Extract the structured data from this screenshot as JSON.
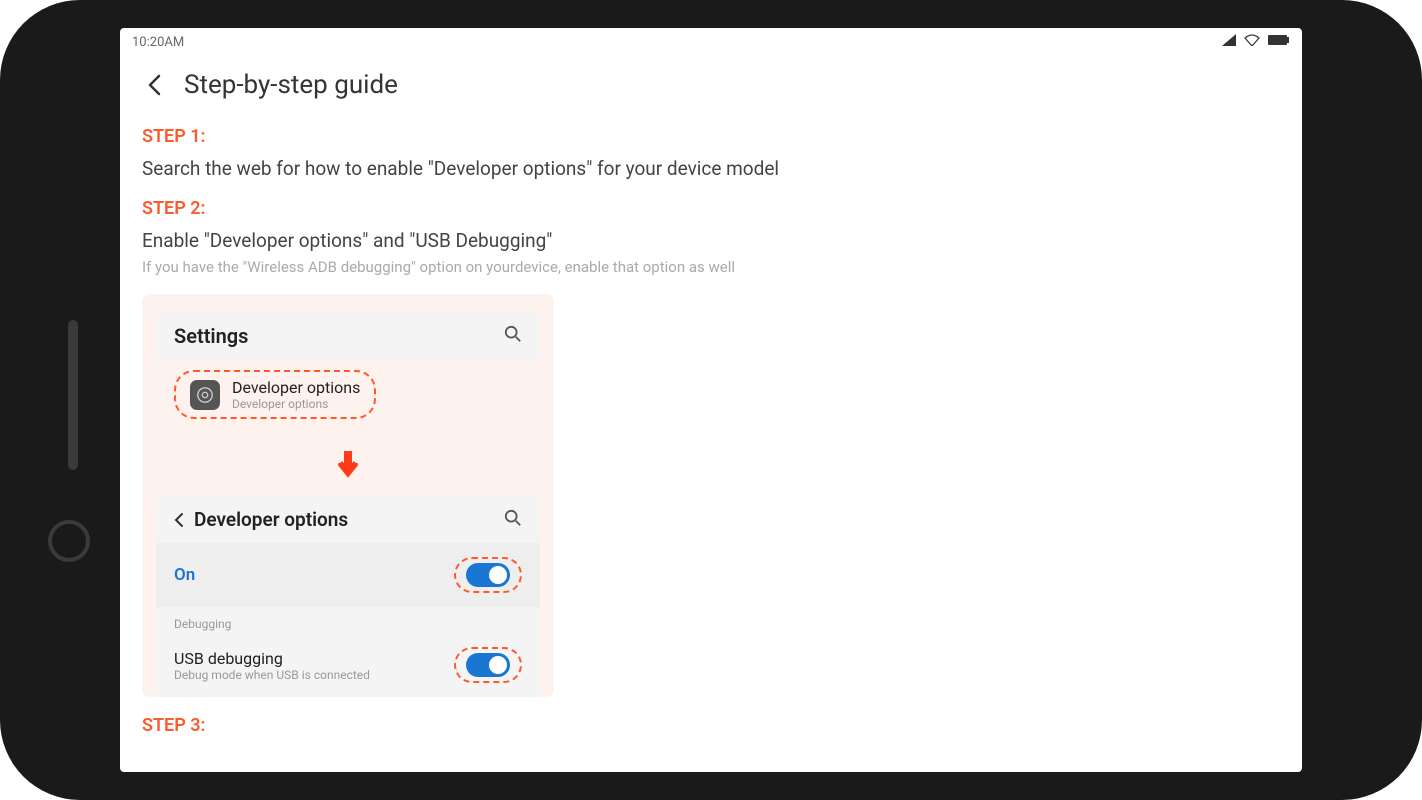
{
  "status_bar": {
    "time": "10:20AM"
  },
  "header": {
    "title": "Step-by-step guide"
  },
  "steps": {
    "step1": {
      "label": "STEP 1:",
      "text": "Search the web for how to enable \"Developer options\" for your device model"
    },
    "step2": {
      "label": "STEP 2:",
      "text": "Enable \"Developer options\" and \"USB Debugging\"",
      "subtext": "If you have the \"Wireless ADB debugging\" option on yourdevice, enable that option as well"
    },
    "step3": {
      "label": "STEP 3:"
    }
  },
  "illustration": {
    "settings_title": "Settings",
    "dev_options_row": {
      "title": "Developer options",
      "subtitle": "Developer options"
    },
    "dev_screen_title": "Developer options",
    "on_label": "On",
    "debugging_section": "Debugging",
    "usb_debugging": {
      "title": "USB debugging",
      "subtitle": "Debug mode when USB is connected"
    }
  }
}
